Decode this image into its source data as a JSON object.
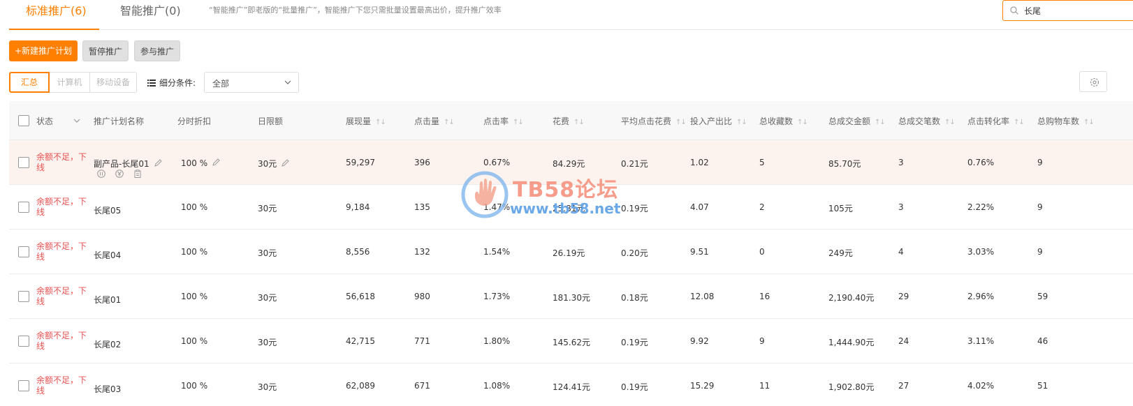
{
  "tabs": [
    {
      "label": "标准推广(6)"
    },
    {
      "label": "智能推广(0)"
    }
  ],
  "tab_hint": "“智能推广”即老版的“批量推广”，智能推广下您只需批量设置最高出价，提升推广效率",
  "search": {
    "value": "长尾"
  },
  "actions": {
    "new_plan": "+新建推广计划",
    "pause": "暂停推广",
    "join": "参与推广"
  },
  "segments": [
    "汇总",
    "计算机",
    "移动设备"
  ],
  "filter": {
    "label": "细分条件:",
    "selected": "全部"
  },
  "columns": [
    "状态",
    "推广计划名称",
    "分时折扣",
    "日限额",
    "展现量",
    "点击量",
    "点击率",
    "花费",
    "平均点击花费",
    "投入产出比",
    "总收藏数",
    "总成交金额",
    "总成交笔数",
    "点击转化率",
    "总购物车数"
  ],
  "rows": [
    {
      "status": "余额不足，下线",
      "name": "副产品-长尾01",
      "discount": "100 %",
      "limit": "30元",
      "impressions": "59,297",
      "clicks": "396",
      "ctr": "0.67%",
      "cost": "84.29元",
      "cpc": "0.21元",
      "roi": "1.02",
      "favorites": "5",
      "gmv": "85.70元",
      "orders": "3",
      "cvr": "0.76%",
      "carts": "9"
    },
    {
      "status": "余额不足，下线",
      "name": "长尾05",
      "discount": "100 %",
      "limit": "30元",
      "impressions": "9,184",
      "clicks": "135",
      "ctr": "1.47%",
      "cost": "25.81元",
      "cpc": "0.19元",
      "roi": "4.07",
      "favorites": "2",
      "gmv": "105元",
      "orders": "3",
      "cvr": "2.22%",
      "carts": "9"
    },
    {
      "status": "余额不足，下线",
      "name": "长尾04",
      "discount": "100 %",
      "limit": "30元",
      "impressions": "8,556",
      "clicks": "132",
      "ctr": "1.54%",
      "cost": "26.19元",
      "cpc": "0.20元",
      "roi": "9.51",
      "favorites": "0",
      "gmv": "249元",
      "orders": "4",
      "cvr": "3.03%",
      "carts": "9"
    },
    {
      "status": "余额不足，下线",
      "name": "长尾01",
      "discount": "100 %",
      "limit": "30元",
      "impressions": "56,618",
      "clicks": "980",
      "ctr": "1.73%",
      "cost": "181.30元",
      "cpc": "0.18元",
      "roi": "12.08",
      "favorites": "16",
      "gmv": "2,190.40元",
      "orders": "29",
      "cvr": "2.96%",
      "carts": "59"
    },
    {
      "status": "余额不足，下线",
      "name": "长尾02",
      "discount": "100 %",
      "limit": "30元",
      "impressions": "42,715",
      "clicks": "771",
      "ctr": "1.80%",
      "cost": "145.62元",
      "cpc": "0.19元",
      "roi": "9.92",
      "favorites": "9",
      "gmv": "1,444.90元",
      "orders": "24",
      "cvr": "3.11%",
      "carts": "46"
    },
    {
      "status": "余额不足，下线",
      "name": "长尾03",
      "discount": "100 %",
      "limit": "30元",
      "impressions": "62,089",
      "clicks": "671",
      "ctr": "1.08%",
      "cost": "124.41元",
      "cpc": "0.19元",
      "roi": "15.29",
      "favorites": "11",
      "gmv": "1,902.80元",
      "orders": "27",
      "cvr": "4.02%",
      "carts": "51"
    }
  ],
  "watermark": {
    "title": "TB58论坛",
    "url": "www.tb58.net"
  },
  "colors": {
    "accent": "#ff8000",
    "status_red": "#e85050",
    "highlight_row": "#fcf3ee"
  }
}
